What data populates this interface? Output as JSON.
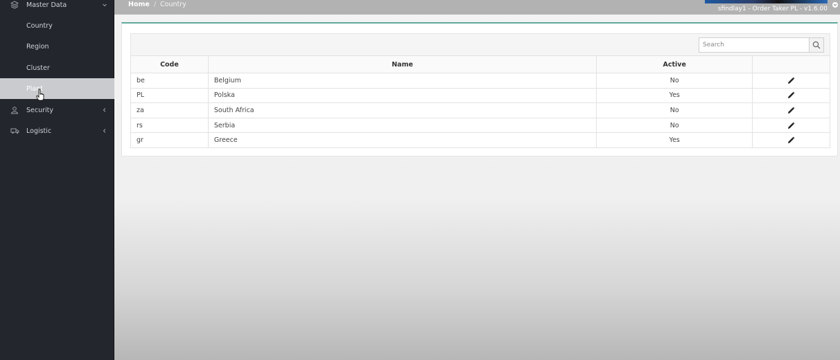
{
  "sidebar": {
    "master_data": "Master Data",
    "sub_items": [
      "Country",
      "Region",
      "Cluster",
      "Plant"
    ],
    "security": "Security",
    "logistic": "Logistic"
  },
  "breadcrumb": {
    "home": "Home",
    "separator": "/",
    "current": "Country"
  },
  "header": {
    "user_info": "sfindlay1 - Order Taker PL - v1.6.00"
  },
  "search": {
    "placeholder": "Search"
  },
  "table": {
    "columns": [
      "Code",
      "Name",
      "Active",
      ""
    ],
    "rows": [
      {
        "code": "be",
        "name": "Belgium",
        "active": "No"
      },
      {
        "code": "PL",
        "name": "Polska",
        "active": "Yes"
      },
      {
        "code": "za",
        "name": "South Africa",
        "active": "No"
      },
      {
        "code": "rs",
        "name": "Serbia",
        "active": "No"
      },
      {
        "code": "gr",
        "name": "Greece",
        "active": "Yes"
      }
    ]
  },
  "colors": {
    "sidebar_bg": "#23262d",
    "active_item_bg": "#c9cbce",
    "panel_accent": "#5fa99a",
    "topbar_bg": "#b2b2b2"
  },
  "icons": [
    "layers-icon",
    "user-icon",
    "truck-icon",
    "chevron-down-icon",
    "chevron-left-icon",
    "search-icon",
    "pencil-icon",
    "cursor-icon"
  ]
}
